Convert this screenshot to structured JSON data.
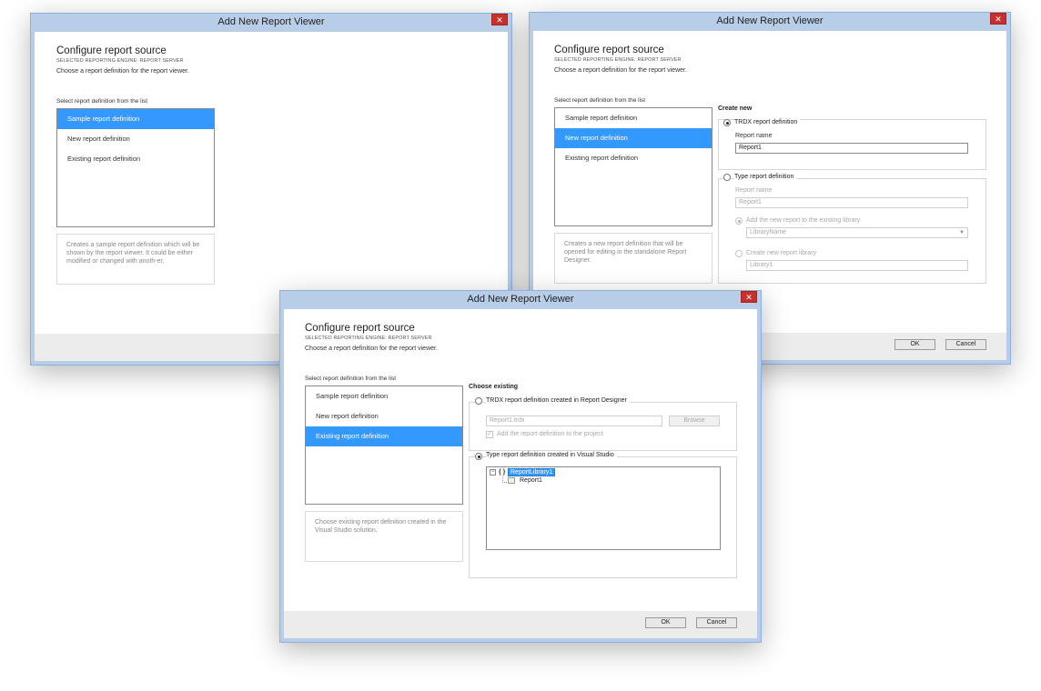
{
  "window_title": "Add New Report Viewer",
  "close_glyph": "✕",
  "header": {
    "title": "Configure report source",
    "subtitle": "SELECTED REPORTING ENGINE: REPORT SERVER",
    "description": "Choose a report definition for the report viewer."
  },
  "list_label": "Select report definition from the list",
  "list_items": [
    "Sample report definition",
    "New report definition",
    "Existing report definition"
  ],
  "buttons": {
    "ok": "OK",
    "cancel": "Cancel",
    "browse": "Browse"
  },
  "dialog_sample": {
    "selected_index": 0,
    "description": "Creates a sample report definition which will be shown by the report viewer. It could be either modified or changed with anoth-er."
  },
  "dialog_new": {
    "selected_index": 1,
    "description": "Creates a new report definition that will be opened for editing in the standalone Report Designer.",
    "section": "Create new",
    "trdx_option": "TRDX report definition",
    "report_name_label": "Report name",
    "report_name_value": "Report1",
    "type_option": "Type report definition",
    "type_report_name_label": "Report name",
    "type_report_name_value": "Report1",
    "existing_library_option": "Add the new report to the existing library",
    "library_select_value": "LibraryName",
    "create_library_option": "Create new report library",
    "new_library_value": "Library1"
  },
  "dialog_existing": {
    "selected_index": 2,
    "description": "Choose existing report definition created in the Visual Studio solution.",
    "section": "Choose existing",
    "trdx_option": "TRDX report definition created in Report Designer",
    "trdx_file_value": "Report1.trdx",
    "add_to_project_label": "Add the report definition to the project",
    "type_option": "Type report definition created in Visual Studio",
    "tree": {
      "toggle": "−",
      "namespace_glyph": "{ }",
      "root": "ReportLibrary1",
      "child": "Report1"
    }
  },
  "colors": {
    "selection": "#3399ff",
    "close_button": "#c9302c",
    "window_frame": "#b8cde8"
  },
  "icons": [
    "close-icon",
    "namespace-icon",
    "report-class-icon",
    "chevron-down-icon"
  ]
}
